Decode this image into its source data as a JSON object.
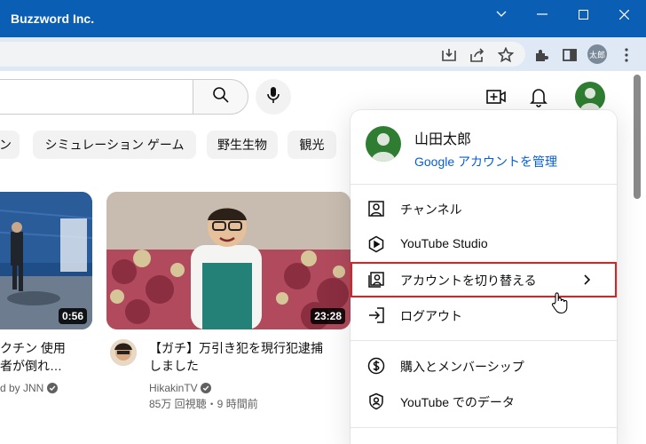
{
  "window": {
    "title": "Buzzword Inc."
  },
  "browser": {
    "profile_badge": "太郎"
  },
  "chips": [
    "ン",
    "シミュレーション ゲーム",
    "野生生物",
    "観光"
  ],
  "videos": [
    {
      "duration": "0:56",
      "title_line1": "クチン 使用",
      "title_line2": "者が倒れ…",
      "channel": "d by JNN"
    },
    {
      "duration": "23:28",
      "title_line1": "【ガチ】万引き犯を現行犯逮捕",
      "title_line2": "しました",
      "channel": "HikakinTV",
      "stats": "85万 回視聴・9 時間前"
    }
  ],
  "menu": {
    "user_name": "山田太郎",
    "manage_link": "Google アカウントを管理",
    "items": [
      {
        "label": "チャンネル",
        "icon": "person-box-icon"
      },
      {
        "label": "YouTube Studio",
        "icon": "studio-play-icon"
      },
      {
        "label": "アカウントを切り替える",
        "icon": "switch-account-icon"
      },
      {
        "label": "ログアウト",
        "icon": "logout-icon"
      },
      {
        "label": "購入とメンバーシップ",
        "icon": "dollar-icon"
      },
      {
        "label": "YouTube でのデータ",
        "icon": "shield-person-icon"
      }
    ]
  },
  "colors": {
    "titlebar": "#0a5fb4",
    "link": "#065fd4",
    "highlight": "#e02020"
  }
}
